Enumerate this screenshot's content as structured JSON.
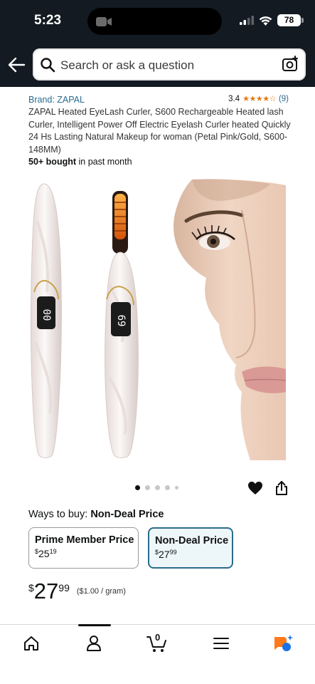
{
  "status_bar": {
    "time": "5:23",
    "battery": "78"
  },
  "search": {
    "placeholder": "Search or ask a question"
  },
  "product": {
    "brand": "Brand: ZAPAL",
    "rating_value": "3.4",
    "rating_stars": "★★★★☆",
    "rating_count": "(9)",
    "title": "ZAPAL Heated EyeLash Curler, S600 Rechargeable Heated lash Curler, Intelligent Power Off Electric Eyelash Curler heated Quickly 24 Hs Lasting Natural Makeup for woman (Petal Pink/Gold, S600-148MM)",
    "bought_bold": "50+ bought",
    "bought_rest": " in past month",
    "device_display_left": "00",
    "device_display_right": "69"
  },
  "buy": {
    "ways_label": "Ways to buy: ",
    "ways_value": "Non-Deal Price",
    "options": [
      {
        "label": "Prime Member Price",
        "symbol": "$",
        "whole": "25",
        "fraction": "19",
        "selected": false
      },
      {
        "label": "Non-Deal Price",
        "symbol": "$",
        "whole": "27",
        "fraction": "99",
        "selected": true
      }
    ],
    "price": {
      "symbol": "$",
      "whole": "27",
      "fraction": "99",
      "unit": "($1.00 / gram)"
    }
  },
  "carousel": {
    "total": 5,
    "active": 0
  },
  "nav": {
    "cart_count": "0",
    "items": [
      "home-icon",
      "account-icon",
      "cart-icon",
      "menu-icon",
      "rufus-icon"
    ]
  },
  "colors": {
    "header": "#131a22",
    "link": "#2a6b8f",
    "stars": "#e47911",
    "selected_border": "#2b6c8a"
  }
}
